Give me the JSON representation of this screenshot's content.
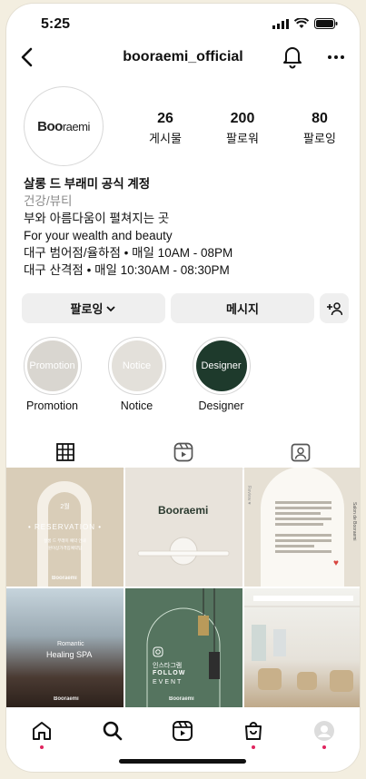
{
  "status_bar": {
    "time": "5:25"
  },
  "header": {
    "username": "booraemi_official"
  },
  "profile": {
    "logo_mark": "Boo",
    "logo_rest": "raemi",
    "stats": [
      {
        "value": "26",
        "label": "게시물"
      },
      {
        "value": "200",
        "label": "팔로워"
      },
      {
        "value": "80",
        "label": "팔로잉"
      }
    ],
    "bio": {
      "name": "살롱 드 부래미 공식 계정",
      "category": "건강/뷰티",
      "lines": [
        "부와 아름다움이 펼쳐지는 곳",
        "For your wealth and beauty",
        "대구 범어점/율하점 • 매일 10AM - 08PM",
        "대구 산격점 • 매일 10:30AM - 08:30PM"
      ]
    }
  },
  "buttons": {
    "following": "팔로잉",
    "message": "메시지"
  },
  "highlights": [
    {
      "inner": "Promotion",
      "label": "Promotion",
      "color": "#d9d6d0"
    },
    {
      "inner": "Notice",
      "label": "Notice",
      "color": "#e3e0da"
    },
    {
      "inner": "Designer",
      "label": "Designer",
      "color": "#1e3a2c"
    }
  ],
  "posts": [
    {
      "month": "2월",
      "title": "• RESERVATION •",
      "sub1": "살롱 드 부래미 예약 안내",
      "sub2": "원이상가격입예약팁"
    },
    {
      "logo": "Booraemi"
    },
    {
      "title": "Review ♥",
      "side": "Salon de Booraemi"
    },
    {
      "title": "Romantic",
      "sub": "Healing SPA"
    },
    {
      "line1": "인스타그램",
      "line2": "FOLLOW",
      "line3": "EVENT"
    },
    {}
  ],
  "watermark": "Booraemi"
}
